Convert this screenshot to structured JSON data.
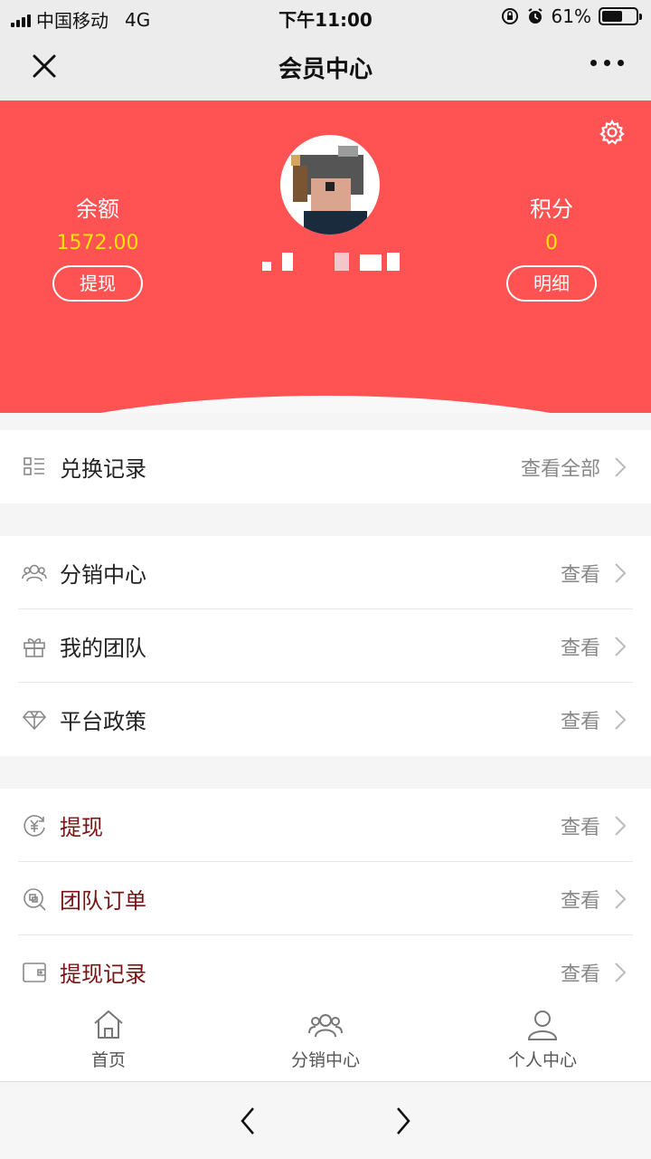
{
  "status": {
    "carrier": "中国移动",
    "network": "4G",
    "time": "下午11:00",
    "battery": "61%",
    "battery_level": 0.61
  },
  "nav": {
    "title": "会员中心",
    "close_icon": "close-icon",
    "more_icon": "more-icon"
  },
  "profile": {
    "balance_label": "余额",
    "balance_value": "1572.00",
    "withdraw_button": "提现",
    "points_label": "积分",
    "points_value": "0",
    "detail_button": "明细",
    "theme_color": "#ff5353",
    "value_color": "#ffe600"
  },
  "exchange": {
    "label": "兑换记录",
    "link": "查看全部"
  },
  "section1": [
    {
      "label": "分销中心",
      "link": "查看",
      "icon": "users-icon"
    },
    {
      "label": "我的团队",
      "link": "查看",
      "icon": "gift-icon"
    },
    {
      "label": "平台政策",
      "link": "查看",
      "icon": "diamond-icon"
    }
  ],
  "section2": [
    {
      "label": "提现",
      "link": "查看",
      "icon": "yuan-refresh-icon"
    },
    {
      "label": "团队订单",
      "link": "查看",
      "icon": "order-search-icon"
    },
    {
      "label": "提现记录",
      "link": "查看",
      "icon": "wallet-icon"
    }
  ],
  "tabbar": [
    {
      "label": "首页",
      "icon": "home-icon"
    },
    {
      "label": "分销中心",
      "icon": "users-icon"
    },
    {
      "label": "个人中心",
      "icon": "person-icon"
    }
  ]
}
